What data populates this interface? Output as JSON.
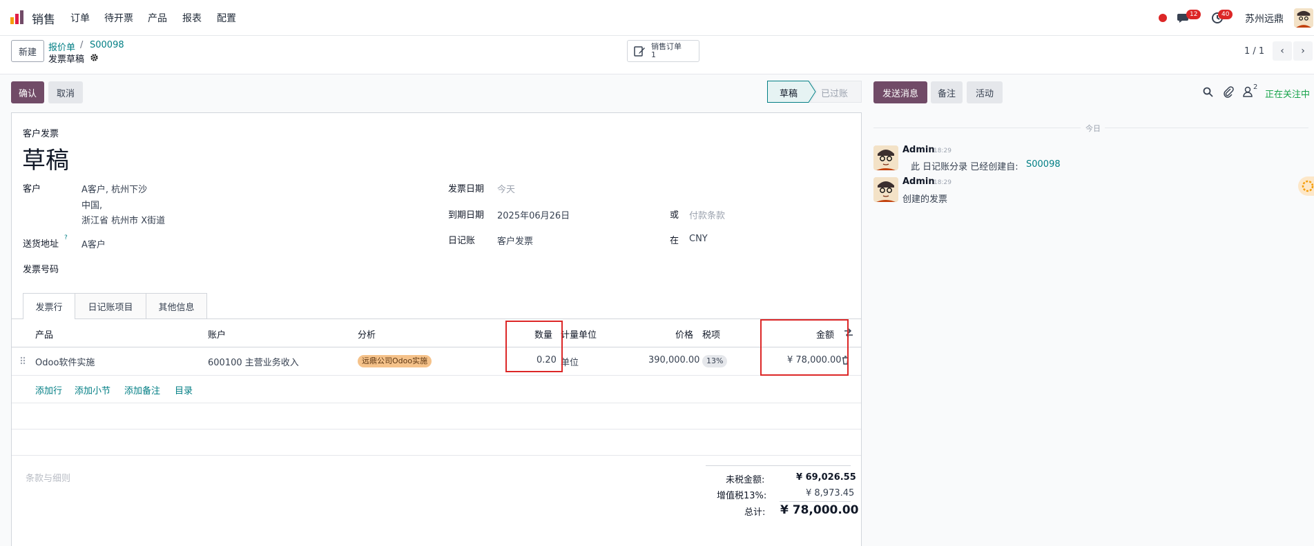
{
  "nav": {
    "app_name": "销售",
    "menu": [
      "订单",
      "待开票",
      "产品",
      "报表",
      "配置"
    ],
    "chat_count": "12",
    "activity_count": "40",
    "company": "苏州远鼎"
  },
  "control": {
    "new_label": "新建",
    "breadcrumb_parent": "报价单",
    "breadcrumb_sep": "/",
    "breadcrumb_order": "S00098",
    "record_title": "发票草稿",
    "smart_button_label": "销售订单",
    "smart_button_count": "1",
    "pager": "1 / 1"
  },
  "actions": {
    "confirm_label": "确认",
    "cancel_label": "取消",
    "status_draft": "草稿",
    "status_posted": "已过账"
  },
  "chatter_actions": {
    "send_message": "发送消息",
    "log_note": "备注",
    "activity": "活动",
    "followers_count": "2",
    "following_label": "正在关注中"
  },
  "invoice": {
    "type_label": "客户发票",
    "state_title": "草稿",
    "customer_label": "客户",
    "customer_line1": "A客户, 杭州下沙",
    "customer_line2": "中国,",
    "customer_line3": "浙江省 杭州市 X街道",
    "delivery_label": "送货地址",
    "delivery_help": "?",
    "delivery_value": "A客户",
    "invoice_number_label": "发票号码",
    "invoice_date_label": "发票日期",
    "invoice_date_placeholder": "今天",
    "due_date_label": "到期日期",
    "due_date_value": "2025年06月26日",
    "or_label": "或",
    "payment_terms_placeholder": "付款条款",
    "journal_label": "日记账",
    "journal_value": "客户发票",
    "in_label": "在",
    "currency_value": "CNY"
  },
  "tabs": [
    "发票行",
    "日记账项目",
    "其他信息"
  ],
  "lines": {
    "headers": {
      "product": "产品",
      "account": "账户",
      "analytic": "分析",
      "quantity": "数量",
      "uom": "计量单位",
      "price": "价格",
      "taxes": "税项",
      "amount": "金额"
    },
    "rows": [
      {
        "product": "Odoo软件实施",
        "account": "600100 主营业务收入",
        "analytic": "远鼎公司Odoo实施",
        "quantity": "0.20",
        "uom": "单位",
        "price": "390,000.00",
        "tax": "13%",
        "amount": "¥ 78,000.00"
      }
    ],
    "add_line": "添加行",
    "add_section": "添加小节",
    "add_note": "添加备注",
    "catalog": "目录"
  },
  "terms_placeholder": "条款与细则",
  "totals": {
    "untaxed_label": "未税金额:",
    "untaxed_value": "¥ 69,026.55",
    "tax_label": "增值税13%:",
    "tax_value": "¥ 8,973.45",
    "total_label": "总计:",
    "total_value": "¥ 78,000.00"
  },
  "chatter": {
    "date_separator": "今日",
    "messages": [
      {
        "author": "Admin",
        "time": "18:29",
        "body": "此 日记账分录 已经创建自:",
        "link": "S00098"
      },
      {
        "author": "Admin",
        "time": "18:29",
        "body": "创建的发票"
      }
    ]
  },
  "colors": {
    "brand": "#714B67",
    "link": "#017e84",
    "highlight_box": "#dc2626"
  }
}
